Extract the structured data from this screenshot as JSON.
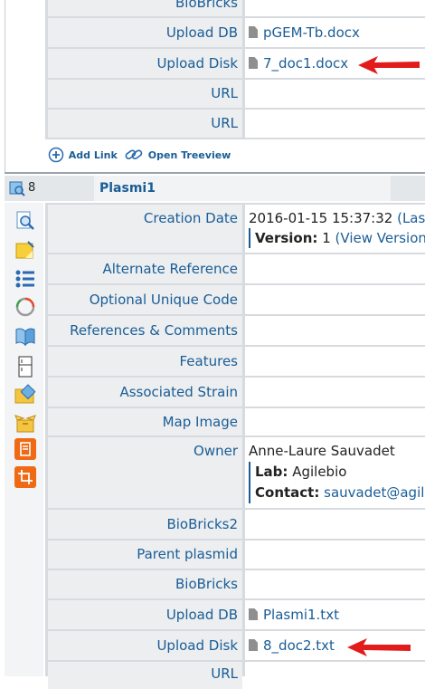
{
  "top": {
    "rows": [
      {
        "label": "BioBricks",
        "value": ""
      },
      {
        "label": "Upload DB",
        "value": "pGEM-Tb.docx",
        "file": true
      },
      {
        "label": "Upload Disk",
        "value": "7_doc1.docx",
        "file": true,
        "arrow": true
      },
      {
        "label": "URL",
        "value": ""
      },
      {
        "label": "URL",
        "value": ""
      }
    ],
    "actions": {
      "add_link": "Add Link",
      "open_treeview": "Open Treeview"
    }
  },
  "record": {
    "count": "8",
    "name": "Plasmi1",
    "creation_date": {
      "label": "Creation Date",
      "value": "2016-01-15 15:37:32",
      "link": "(Las",
      "version_label": "Version:",
      "version_value": "1",
      "version_link": "(View Version"
    },
    "fields": [
      {
        "label": "Alternate Reference",
        "value": ""
      },
      {
        "label": "Optional Unique Code",
        "value": ""
      },
      {
        "label": "References & Comments",
        "value": ""
      },
      {
        "label": "Features",
        "value": ""
      },
      {
        "label": "Associated Strain",
        "value": ""
      },
      {
        "label": "Map Image",
        "value": ""
      }
    ],
    "owner": {
      "label": "Owner",
      "name": "Anne-Laure Sauvadet",
      "lab_label": "Lab:",
      "lab_value": "Agilebio",
      "contact_label": "Contact:",
      "contact_value": "sauvadet@agile"
    },
    "fields2": [
      {
        "label": "BioBricks2",
        "value": ""
      },
      {
        "label": "Parent plasmid",
        "value": ""
      },
      {
        "label": "BioBricks",
        "value": ""
      },
      {
        "label": "Upload DB",
        "value": "Plasmi1.txt",
        "file": true
      },
      {
        "label": "Upload Disk",
        "value": "8_doc2.txt",
        "file": true,
        "arrow": true
      },
      {
        "label": "URL",
        "value": ""
      }
    ]
  },
  "side_icons": [
    "magnifier-doc-icon",
    "sticky-note-icon",
    "list-icon",
    "ring-icon",
    "book-icon",
    "fridge-icon",
    "tag-folder-icon",
    "open-box-icon",
    "notebook-icon",
    "crop-icon"
  ],
  "colors": {
    "label_bg": "#eceef0",
    "link": "#1a5d96",
    "arrow": "#e21b1b",
    "border": "#d7dbdf",
    "orange": "#f06a16"
  }
}
